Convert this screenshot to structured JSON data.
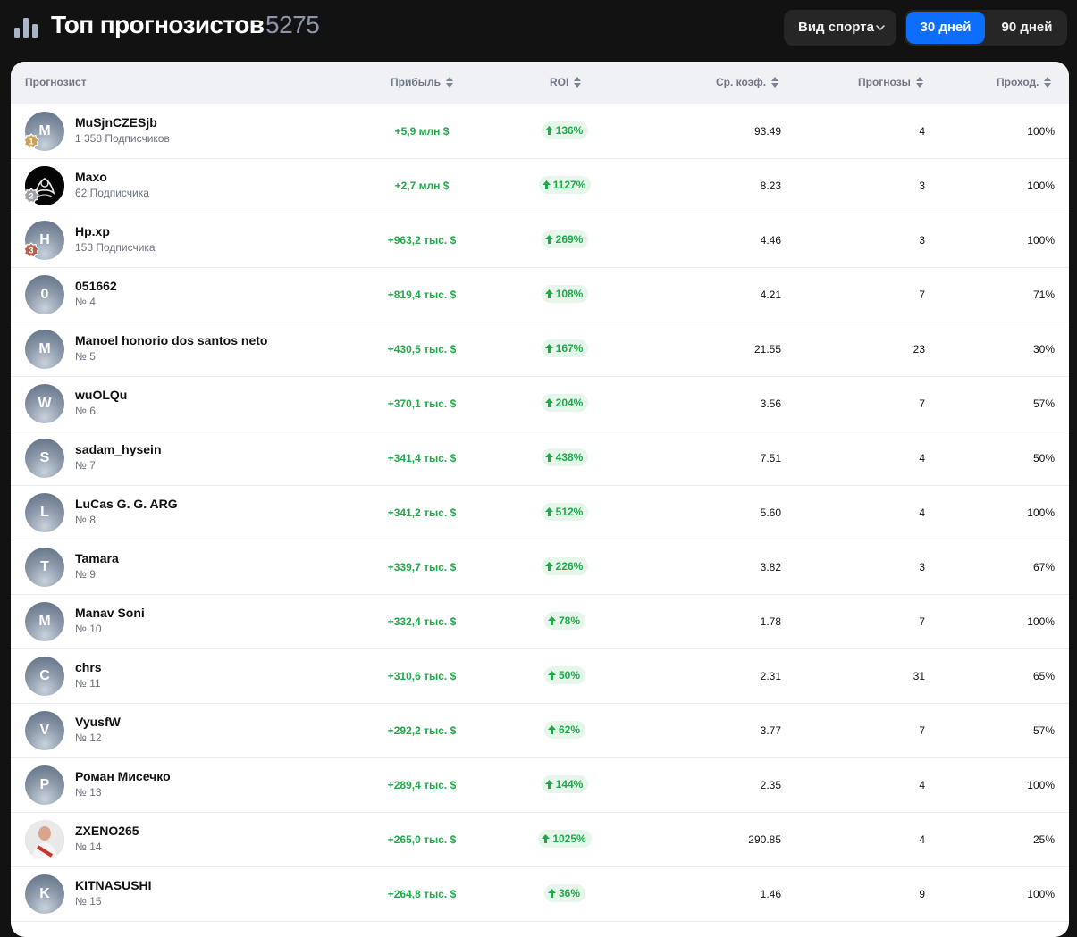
{
  "header": {
    "title": "Топ прогнозистов",
    "count": "5275",
    "sport_filter": "Вид спорта",
    "periods": [
      {
        "label": "30 дней",
        "active": true
      },
      {
        "label": "90 дней",
        "active": false
      }
    ]
  },
  "table": {
    "columns": {
      "forecaster": "Прогнозист",
      "profit": "Прибыль",
      "roi": "ROI",
      "avg_coef": "Ср. коэф.",
      "forecasts": "Прогнозы",
      "pass_rate": "Проход."
    },
    "rows": [
      {
        "initial": "M",
        "name": "MuSjnCZESjb",
        "sub": "1 358 Подписчиков",
        "profit": "+5,9 млн $",
        "roi": "136%",
        "coef": "93.49",
        "forecasts": "4",
        "pass": "100%",
        "medal": "1",
        "avatar": "initial"
      },
      {
        "initial": "",
        "name": "Maxo",
        "sub": "62 Подписчика",
        "profit": "+2,7 млн $",
        "roi": "1127%",
        "coef": "8.23",
        "forecasts": "3",
        "pass": "100%",
        "medal": "2",
        "avatar": "photo-dark"
      },
      {
        "initial": "H",
        "name": "Hp.xp",
        "sub": "153 Подписчика",
        "profit": "+963,2 тыс. $",
        "roi": "269%",
        "coef": "4.46",
        "forecasts": "3",
        "pass": "100%",
        "medal": "3",
        "avatar": "initial"
      },
      {
        "initial": "0",
        "name": "051662",
        "sub": "№ 4",
        "profit": "+819,4 тыс. $",
        "roi": "108%",
        "coef": "4.21",
        "forecasts": "7",
        "pass": "71%",
        "medal": "",
        "avatar": "initial"
      },
      {
        "initial": "M",
        "name": "Manoel honorio dos santos neto",
        "sub": "№ 5",
        "profit": "+430,5 тыс. $",
        "roi": "167%",
        "coef": "21.55",
        "forecasts": "23",
        "pass": "30%",
        "medal": "",
        "avatar": "initial"
      },
      {
        "initial": "W",
        "name": "wuOLQu",
        "sub": "№ 6",
        "profit": "+370,1 тыс. $",
        "roi": "204%",
        "coef": "3.56",
        "forecasts": "7",
        "pass": "57%",
        "medal": "",
        "avatar": "initial"
      },
      {
        "initial": "S",
        "name": "sadam_hysein",
        "sub": "№ 7",
        "profit": "+341,4 тыс. $",
        "roi": "438%",
        "coef": "7.51",
        "forecasts": "4",
        "pass": "50%",
        "medal": "",
        "avatar": "initial"
      },
      {
        "initial": "L",
        "name": "LuCas G. G. ARG",
        "sub": "№ 8",
        "profit": "+341,2 тыс. $",
        "roi": "512%",
        "coef": "5.60",
        "forecasts": "4",
        "pass": "100%",
        "medal": "",
        "avatar": "initial"
      },
      {
        "initial": "T",
        "name": "Tamara",
        "sub": "№ 9",
        "profit": "+339,7 тыс. $",
        "roi": "226%",
        "coef": "3.82",
        "forecasts": "3",
        "pass": "67%",
        "medal": "",
        "avatar": "initial"
      },
      {
        "initial": "M",
        "name": "Manav Soni",
        "sub": "№ 10",
        "profit": "+332,4 тыс. $",
        "roi": "78%",
        "coef": "1.78",
        "forecasts": "7",
        "pass": "100%",
        "medal": "",
        "avatar": "initial"
      },
      {
        "initial": "C",
        "name": "chrs",
        "sub": "№ 11",
        "profit": "+310,6 тыс. $",
        "roi": "50%",
        "coef": "2.31",
        "forecasts": "31",
        "pass": "65%",
        "medal": "",
        "avatar": "initial"
      },
      {
        "initial": "V",
        "name": "VyusfW",
        "sub": "№ 12",
        "profit": "+292,2 тыс. $",
        "roi": "62%",
        "coef": "3.77",
        "forecasts": "7",
        "pass": "57%",
        "medal": "",
        "avatar": "initial"
      },
      {
        "initial": "Р",
        "name": "Роман Мисечко",
        "sub": "№ 13",
        "profit": "+289,4 тыс. $",
        "roi": "144%",
        "coef": "2.35",
        "forecasts": "4",
        "pass": "100%",
        "medal": "",
        "avatar": "initial"
      },
      {
        "initial": "",
        "name": "ZXENO265",
        "sub": "№ 14",
        "profit": "+265,0 тыс. $",
        "roi": "1025%",
        "coef": "290.85",
        "forecasts": "4",
        "pass": "25%",
        "medal": "",
        "avatar": "photo-light"
      },
      {
        "initial": "K",
        "name": "KITNASUSHI",
        "sub": "№ 15",
        "profit": "+264,8 тыс. $",
        "roi": "36%",
        "coef": "1.46",
        "forecasts": "9",
        "pass": "100%",
        "medal": "",
        "avatar": "initial"
      }
    ]
  },
  "colors": {
    "background": "#121212",
    "accent": "#0d6efd",
    "positive": "#1faa4a",
    "gold": "#c9a15a",
    "silver": "#9ea3aa",
    "bronze": "#b5614f"
  },
  "icons": {
    "logo": "bar-chart-icon",
    "dropdown": "chevron-down-icon",
    "sort": "sort-icon",
    "roi": "arrow-up-icon",
    "medal": "medal-badge-icon"
  }
}
